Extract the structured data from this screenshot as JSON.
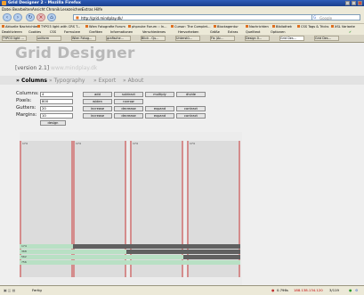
{
  "window": {
    "title": "Grid Designer 2 - Mozilla Firefox"
  },
  "menu": [
    "Datei",
    "Bearbeiten",
    "Ansicht",
    "Chronik",
    "Lesezeichen",
    "Extras",
    "Hilfe"
  ],
  "nav": {
    "url": "http://grid.mindplay.dk/",
    "search_placeholder": "Google"
  },
  "bookmarks": [
    "Aktuelle Nachrichten",
    "TYPO3 light with CRS T...",
    "Wien Fotografie Forum",
    "phpnuke Forum :: In...",
    "Cursor: The Complet...",
    "Blockagentur",
    "Nachrichten",
    "Bibliothek",
    "CSS Tags & Tricks",
    "XSL Variante"
  ],
  "toolbar2": [
    "Deaktivieren",
    "Cookies",
    "CSS",
    "Formulare",
    "Grafiken",
    "Informationen",
    "Verschiedenes",
    "Hervorheben",
    "Größe",
    "Extras",
    "Quelltext",
    "Optionen"
  ],
  "tabs": [
    "TYPO3 light ...",
    "uniform",
    "Wien Fotog...",
    "grafische...",
    "Blick - Qu...",
    "Unterstü...",
    "Fix (Ac...",
    "Design 0...",
    "Grid Des...",
    "Grid Des..."
  ],
  "page": {
    "title": "Grid Designer",
    "version": "[version 2.1]",
    "site_link": "www.mindplay.dk",
    "nav_items": [
      "» Columns",
      "» Typography",
      "» Export",
      "» About"
    ],
    "fields": [
      {
        "label": "Columns:",
        "value": "4"
      },
      {
        "label": "Pixels:",
        "value": "800"
      },
      {
        "label": "Gutters:",
        "value": "20"
      },
      {
        "label": "Margins:",
        "value": "10"
      }
    ],
    "column_buttons": [
      "add",
      "subtract",
      "multiply",
      "divide"
    ],
    "pixel_buttons": [
      "widen",
      "narrow"
    ],
    "gutter_buttons": [
      "increase",
      "decrease",
      "expand",
      "contract"
    ],
    "margin_buttons": [
      "increase",
      "decrease",
      "expand",
      "contract"
    ],
    "design_button": "design",
    "col_ticks": [
      "174",
      "174",
      "174",
      "174"
    ],
    "measures": [
      "174",
      "368",
      "562",
      "756"
    ]
  },
  "status": {
    "left": "Fertig",
    "yslow": "0.796s",
    "ip": "188.138.134.120",
    "pages": "3/119"
  }
}
